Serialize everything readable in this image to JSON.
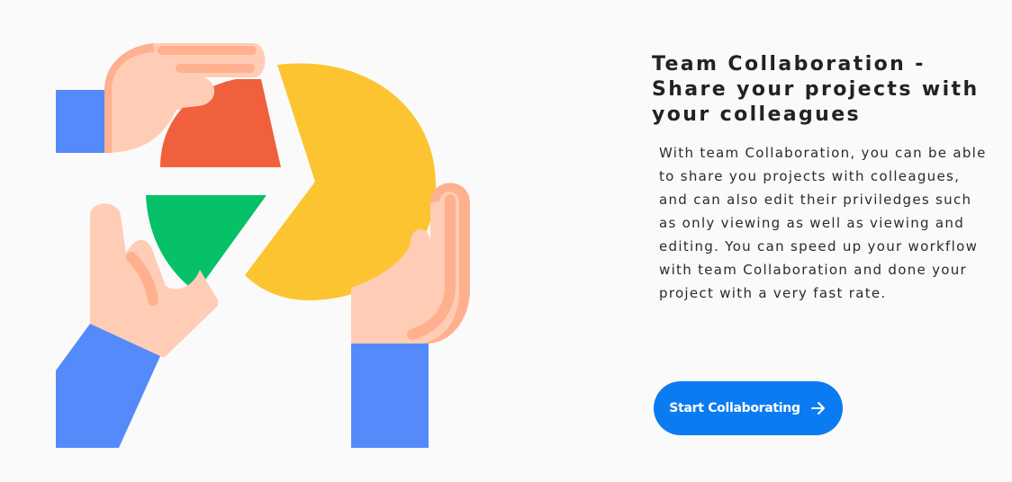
{
  "hero": {
    "illustration_icon": "team-collaboration-pie-chart-hands-illustration",
    "title": "Team Collaboration - Share your projects with your colleagues",
    "description": "With team Collaboration, you can be able to share you projects with colleagues, and can also edit their priviledges such as only viewing as well as viewing and editing. You can speed up your workflow with team Collaboration and done your project with a very fast rate.",
    "cta_label": "Start Collaborating",
    "cta_icon": "arrow-right-icon"
  },
  "colors": {
    "background": "#fafafa",
    "button": "#0b7bf2",
    "sleeve": "#558afa",
    "skin": "#ffcdb5",
    "skin_shadow": "#ffb08e",
    "pie_yellow": "#fdc432",
    "pie_red": "#f0603c",
    "pie_green": "#06c167"
  }
}
